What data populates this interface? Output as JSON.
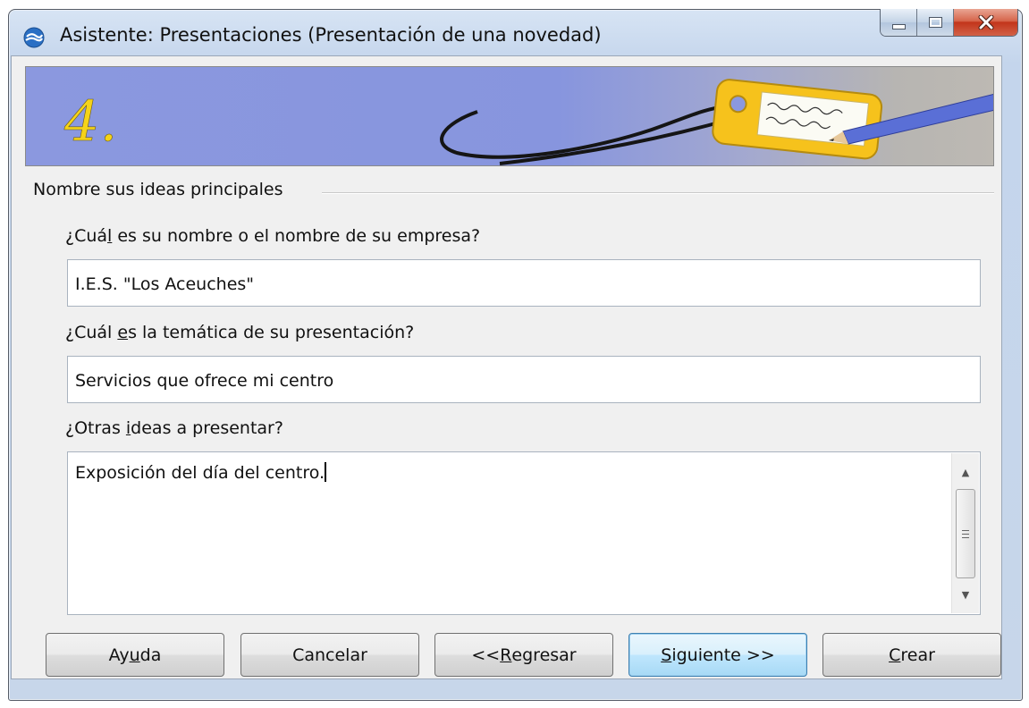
{
  "window": {
    "title": "Asistente: Presentaciones (Presentación de una novedad)"
  },
  "banner": {
    "step_number": "4."
  },
  "group": {
    "title": "Nombre sus ideas principales"
  },
  "fields": {
    "name": {
      "label_pre": "¿Cuá",
      "label_access": "l",
      "label_post": " es su nombre o el nombre de su empresa?",
      "value": "I.E.S. \"Los Aceuches\""
    },
    "topic": {
      "label_pre": "¿Cuál ",
      "label_access": "e",
      "label_post": "s la temática de su presentación?",
      "value": "Servicios que ofrece mi centro"
    },
    "other": {
      "label_pre": "¿Otras ",
      "label_access": "i",
      "label_post": "deas a presentar?",
      "value": "Exposición del día del centro."
    }
  },
  "buttons": {
    "help": {
      "pre": "Ay",
      "access": "u",
      "post": "da"
    },
    "cancel": {
      "label": "Cancelar"
    },
    "back": {
      "pre": "<< ",
      "access": "R",
      "post": "egresar"
    },
    "next": {
      "pre": "",
      "access": "S",
      "post": "iguiente >>"
    },
    "create": {
      "pre": "",
      "access": "C",
      "post": "rear"
    }
  },
  "icons": {
    "app": "app-logo-icon",
    "minimize": "minimize-icon",
    "maximize": "maximize-icon",
    "close": "close-icon",
    "scroll_up": "scroll-up-arrow-icon",
    "scroll_down": "scroll-down-arrow-icon"
  },
  "colors": {
    "banner_blue": "#8b98df",
    "step_number_yellow": "#f5d319",
    "close_button_red": "#c2351b",
    "default_button_blue": "#bee6fd"
  }
}
